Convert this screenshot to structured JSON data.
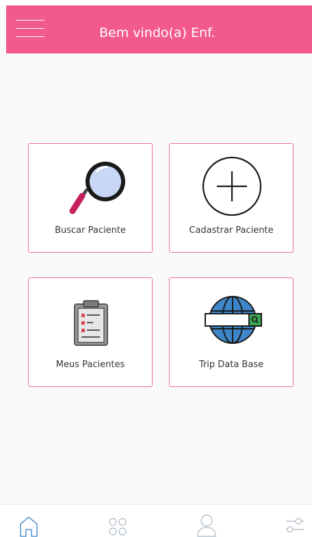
{
  "header": {
    "menu_icon": "hamburger-menu-icon",
    "title": "Bem vindo(a) Enf."
  },
  "cards": [
    {
      "label": "Buscar Paciente",
      "icon": "magnifier-icon"
    },
    {
      "label": "Cadastrar Paciente",
      "icon": "plus-circle-icon"
    },
    {
      "label": "Meus Pacientes",
      "icon": "clipboard-list-icon"
    },
    {
      "label": "Trip Data Base",
      "icon": "globe-search-icon"
    }
  ],
  "bottom_nav": [
    {
      "icon": "home-icon",
      "active": true
    },
    {
      "icon": "apps-grid-icon",
      "active": false
    },
    {
      "icon": "user-icon",
      "active": false
    },
    {
      "icon": "sliders-icon",
      "active": false
    }
  ],
  "colors": {
    "header_bg": "#f25a8b",
    "card_border": "#ef6f98",
    "nav_active": "#5b9bd5",
    "nav_inactive": "#b8c2cc"
  }
}
